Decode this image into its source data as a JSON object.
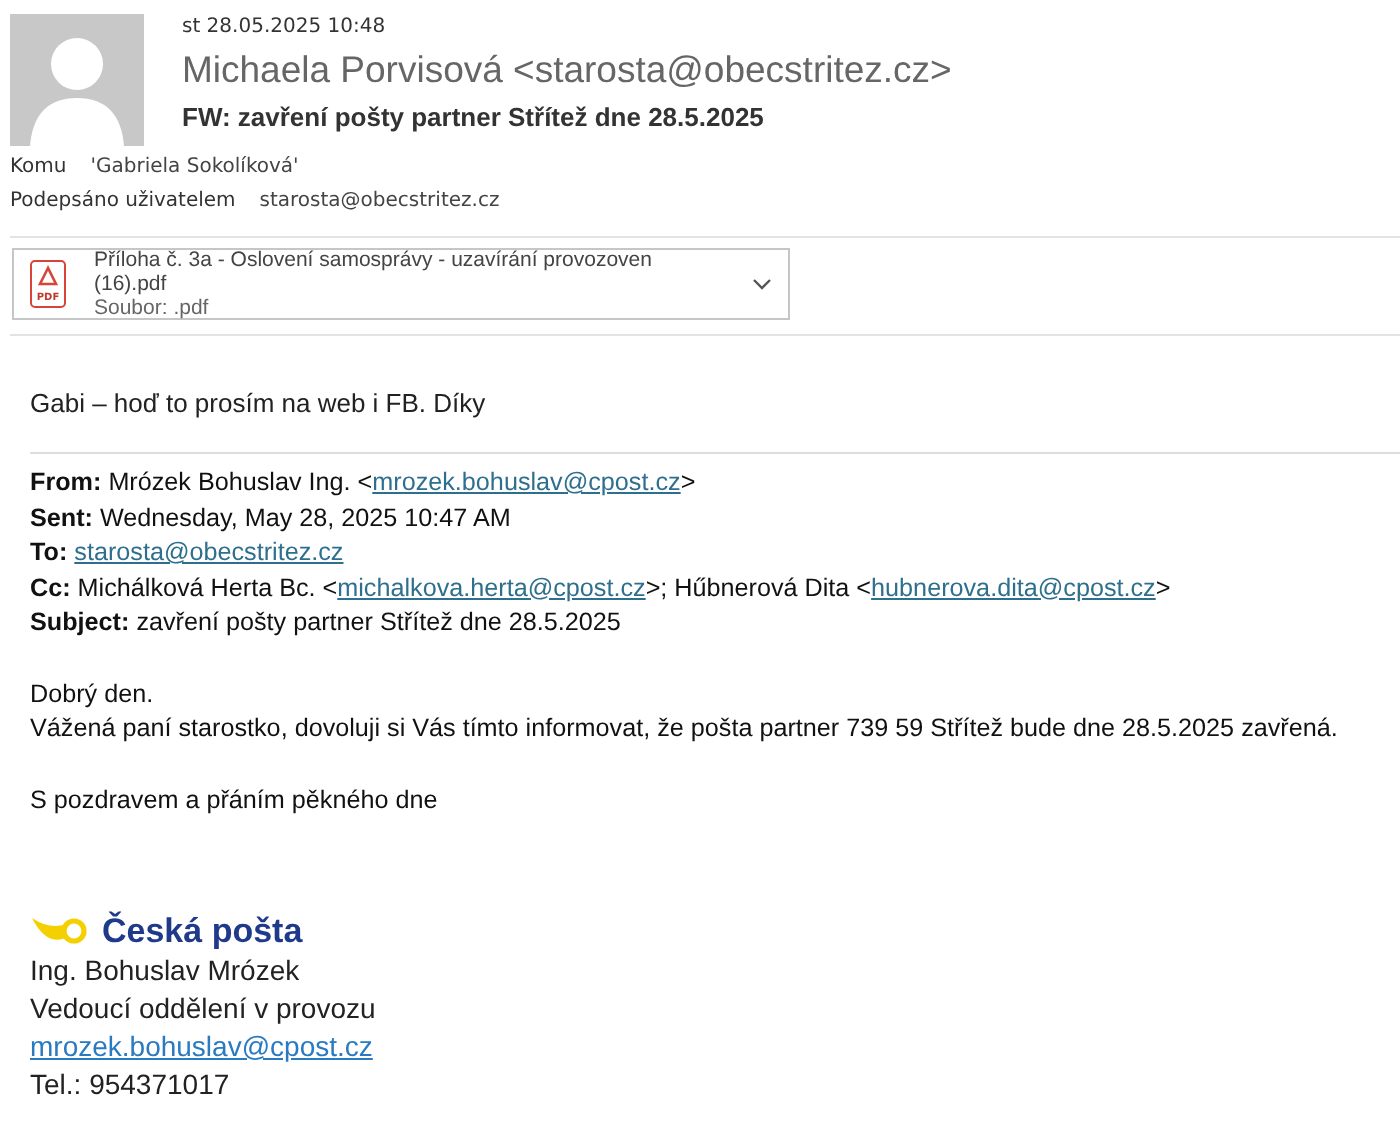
{
  "message": {
    "date": "st 28.05.2025 10:48",
    "sender": "Michaela Porvisová <starosta@obecstritez.cz>",
    "subject": "FW: zavření pošty partner Střítež dne 28.5.2025",
    "recipients": [
      {
        "label": "Komu",
        "value": "'Gabriela Sokolíková'"
      },
      {
        "label": "Podepsáno uživatelem",
        "value": "starosta@obecstritez.cz"
      }
    ]
  },
  "attachment": {
    "name": "Příloha č. 3a - Oslovení samosprávy - uzavírání provozoven (16).pdf",
    "type": "Soubor: .pdf",
    "icon_label": "PDF"
  },
  "note": "Gabi – hoď to prosím na web i FB. Díky",
  "forwarded_headers": [
    {
      "label": "From:",
      "parts": [
        {
          "kind": "text",
          "text": "Mrózek Bohuslav Ing. <"
        },
        {
          "kind": "link",
          "text": "mrozek.bohuslav@cpost.cz"
        },
        {
          "kind": "text",
          "text": ">"
        }
      ]
    },
    {
      "label": "Sent:",
      "parts": [
        {
          "kind": "text",
          "text": "Wednesday, May 28, 2025 10:47 AM"
        }
      ]
    },
    {
      "label": "To:",
      "parts": [
        {
          "kind": "link",
          "text": "starosta@obecstritez.cz"
        }
      ]
    },
    {
      "label": "Cc:",
      "parts": [
        {
          "kind": "text",
          "text": "Michálková Herta Bc. <"
        },
        {
          "kind": "link",
          "text": "michalkova.herta@cpost.cz"
        },
        {
          "kind": "text",
          "text": ">; Hűbnerová Dita <"
        },
        {
          "kind": "link",
          "text": "hubnerova.dita@cpost.cz"
        },
        {
          "kind": "text",
          "text": ">"
        }
      ]
    },
    {
      "label": "Subject:",
      "parts": [
        {
          "kind": "text",
          "text": "zavření pošty partner Střítež dne 28.5.2025"
        }
      ]
    }
  ],
  "body": [
    "Dobrý den.",
    "Vážená paní starostko, dovoluji si Vás tímto informovat, že pošta partner 739 59 Střítež bude dne 28.5.2025 zavřená."
  ],
  "closing": "S pozdravem a přáním pěkného dne",
  "signature": {
    "logo_text": "Česká pošta",
    "lines": [
      {
        "kind": "text",
        "text": "Ing. Bohuslav Mrózek"
      },
      {
        "kind": "text",
        "text": "Vedoucí oddělení v provozu"
      },
      {
        "kind": "link",
        "text": "mrozek.bohuslav@cpost.cz"
      },
      {
        "kind": "text",
        "text": "Tel.: 954371017"
      }
    ]
  }
}
